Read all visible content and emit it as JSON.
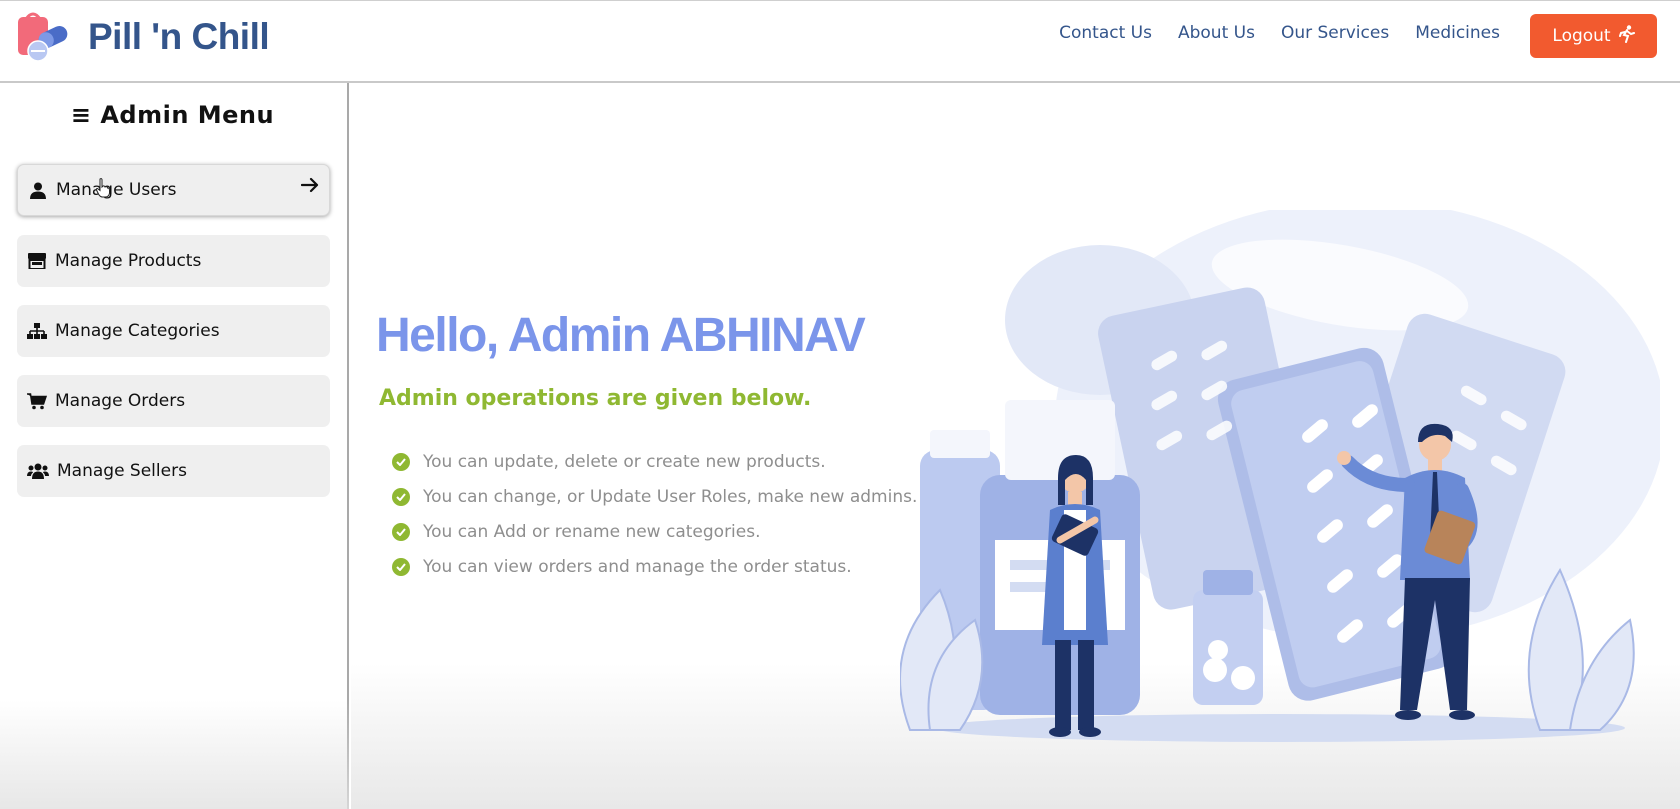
{
  "brand": {
    "name": "Pill 'n Chill",
    "logo_icon": "pill-bag-logo-icon"
  },
  "nav": [
    {
      "label": "Contact Us"
    },
    {
      "label": "About Us"
    },
    {
      "label": "Our Services"
    },
    {
      "label": "Medicines"
    }
  ],
  "logout": {
    "label": "Logout",
    "icon": "running-person-icon"
  },
  "sidebar": {
    "title": "≡ Admin Menu",
    "items": [
      {
        "label": "Manage Users",
        "icon": "user-icon"
      },
      {
        "label": "Manage Products",
        "icon": "store-icon"
      },
      {
        "label": "Manage Categories",
        "icon": "sitemap-icon"
      },
      {
        "label": "Manage Orders",
        "icon": "cart-icon"
      },
      {
        "label": "Manage Sellers",
        "icon": "users-icon"
      }
    ]
  },
  "main": {
    "greeting": "Hello, Admin ABHINAV",
    "subtitle": "Admin operations are given below.",
    "operations": [
      "You can update, delete or create new products.",
      "You can change, or Update User Roles, make new admins.",
      "You can Add or rename new categories.",
      "You can view orders and manage the order status."
    ]
  },
  "colors": {
    "brand": "#34558b",
    "logout": "#f25a2f",
    "greeting": "#7b95ea",
    "subtitle": "#8fb832",
    "check": "#8fb832"
  }
}
